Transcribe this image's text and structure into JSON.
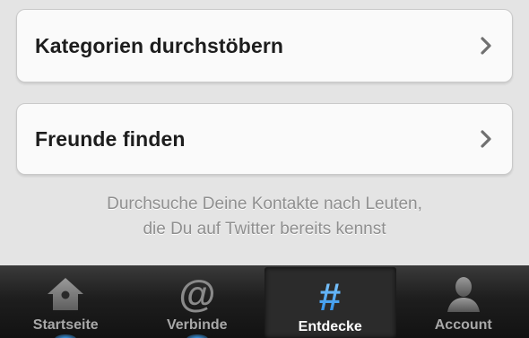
{
  "cells": [
    {
      "label": "Kategorien durchstöbern"
    },
    {
      "label": "Freunde finden"
    }
  ],
  "hint": {
    "line1": "Durchsuche Deine Kontakte nach Leuten,",
    "line2": "die Du auf Twitter bereits kennst"
  },
  "tabbar": {
    "tabs": [
      {
        "label": "Startseite",
        "icon": "home-icon",
        "active": false
      },
      {
        "label": "Verbinde",
        "icon": "at-icon",
        "active": false
      },
      {
        "label": "Entdecke",
        "icon": "hash-icon",
        "active": true
      },
      {
        "label": "Account",
        "icon": "person-icon",
        "active": false
      }
    ]
  },
  "colors": {
    "accent": "#3fa8ff",
    "background": "#e4e4e4",
    "tabbar": "#1e1e1e"
  }
}
